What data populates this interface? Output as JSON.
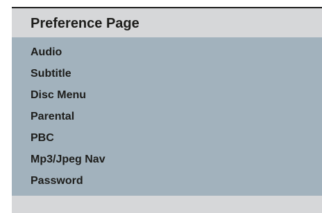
{
  "menu": {
    "title": "Preference Page",
    "items": [
      {
        "label": "Audio"
      },
      {
        "label": "Subtitle"
      },
      {
        "label": "Disc Menu"
      },
      {
        "label": "Parental"
      },
      {
        "label": "PBC"
      },
      {
        "label": "Mp3/Jpeg Nav"
      },
      {
        "label": "Password"
      }
    ]
  },
  "colors": {
    "header_background": "#d6d7d9",
    "list_background": "#a2b2bd",
    "text": "#1d1d1b",
    "top_border": "#1a1a1a"
  }
}
